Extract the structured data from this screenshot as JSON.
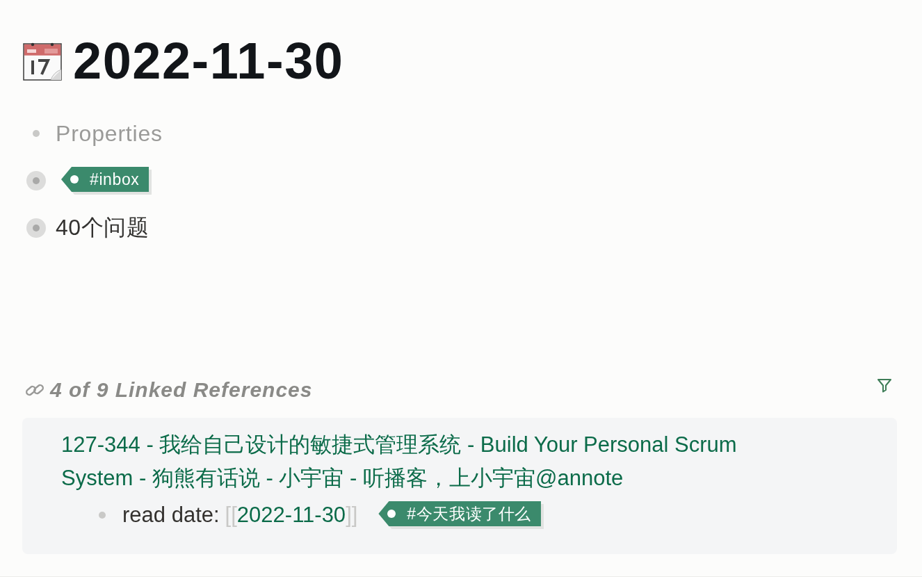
{
  "page": {
    "title": "2022-11-30"
  },
  "blocks": [
    {
      "kind": "properties",
      "text": "Properties",
      "collapsed": false
    },
    {
      "kind": "tag",
      "text": "#inbox",
      "collapsed": true
    },
    {
      "kind": "text",
      "text": "40个问题",
      "collapsed": true
    }
  ],
  "linked_references": {
    "heading": "4 of 9 Linked References",
    "groups": [
      {
        "title": "127-344 - 我给自己设计的敏捷式管理系统 - Build Your Personal Scrum System - 狗熊有话说 - 小宇宙 - 听播客，上小宇宙@annote",
        "children": [
          {
            "label": "read date:",
            "brackets": [
              "[[",
              "]]"
            ],
            "link": "2022-11-30",
            "tag": "#今天我读了什么",
            "collapsed": false
          }
        ]
      }
    ]
  }
}
